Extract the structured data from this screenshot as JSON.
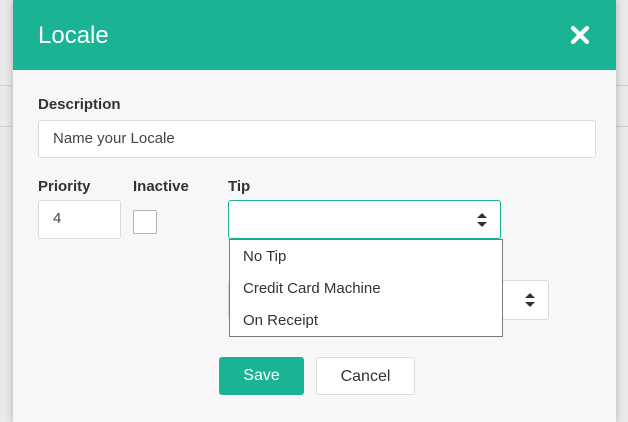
{
  "modal": {
    "title": "Locale",
    "close_icon": "close-icon"
  },
  "form": {
    "description_label": "Description",
    "description_value": "Name your Locale",
    "priority_label": "Priority",
    "priority_value": "4",
    "inactive_label": "Inactive",
    "inactive_checked": false,
    "tip_label": "Tip",
    "tip_value": "",
    "second_select_value": ""
  },
  "tip_dropdown": {
    "options": [
      "No Tip",
      "Credit Card Machine",
      "On Receipt"
    ]
  },
  "footer": {
    "save_label": "Save",
    "cancel_label": "Cancel"
  },
  "colors": {
    "accent": "#1ab394",
    "focus_border": "#1ab394"
  }
}
